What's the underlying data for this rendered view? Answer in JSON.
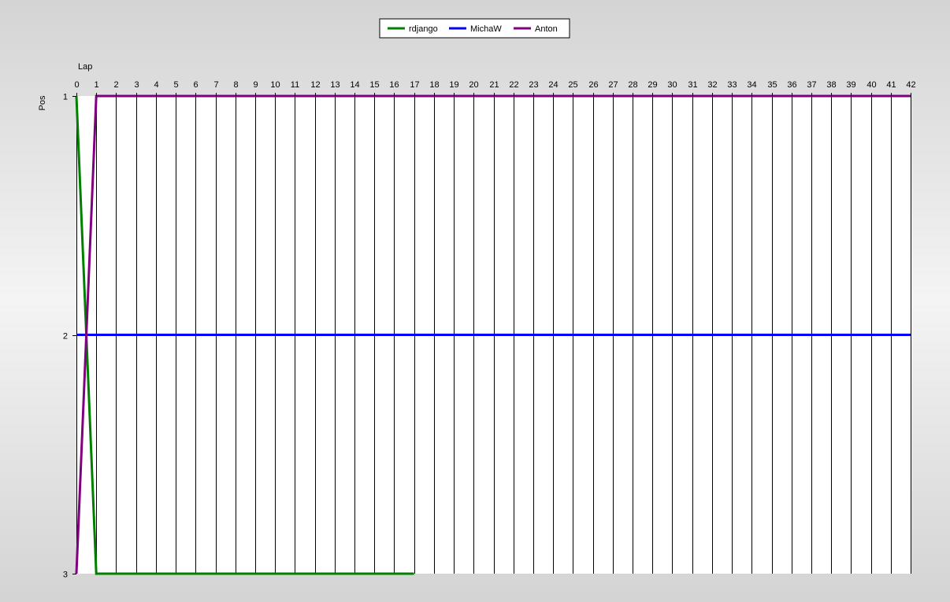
{
  "chart_data": {
    "type": "line",
    "xlabel": "Lap",
    "ylabel": "Pos",
    "x_axis_position": "top",
    "y_inverted": true,
    "xlim": [
      0,
      42
    ],
    "ylim": [
      1,
      3
    ],
    "x_ticks": [
      0,
      1,
      2,
      3,
      4,
      5,
      6,
      7,
      8,
      9,
      10,
      11,
      12,
      13,
      14,
      15,
      16,
      17,
      18,
      19,
      20,
      21,
      22,
      23,
      24,
      25,
      26,
      27,
      28,
      29,
      30,
      31,
      32,
      33,
      34,
      35,
      36,
      37,
      38,
      39,
      40,
      41,
      42
    ],
    "y_ticks": [
      1,
      2,
      3
    ],
    "grid": "vertical",
    "legend_position": "top-center",
    "series": [
      {
        "name": "rdjango",
        "color": "#008000",
        "points": [
          [
            0,
            1
          ],
          [
            1,
            3
          ],
          [
            2,
            3
          ],
          [
            3,
            3
          ],
          [
            4,
            3
          ],
          [
            5,
            3
          ],
          [
            6,
            3
          ],
          [
            7,
            3
          ],
          [
            8,
            3
          ],
          [
            9,
            3
          ],
          [
            10,
            3
          ],
          [
            11,
            3
          ],
          [
            12,
            3
          ],
          [
            13,
            3
          ],
          [
            14,
            3
          ],
          [
            15,
            3
          ],
          [
            16,
            3
          ],
          [
            17,
            3
          ]
        ]
      },
      {
        "name": "MichaW",
        "color": "#0000ff",
        "points": [
          [
            0,
            2
          ],
          [
            42,
            2
          ]
        ]
      },
      {
        "name": "Anton",
        "color": "#800080",
        "points": [
          [
            0,
            3
          ],
          [
            1,
            1
          ],
          [
            42,
            1
          ]
        ]
      }
    ]
  }
}
